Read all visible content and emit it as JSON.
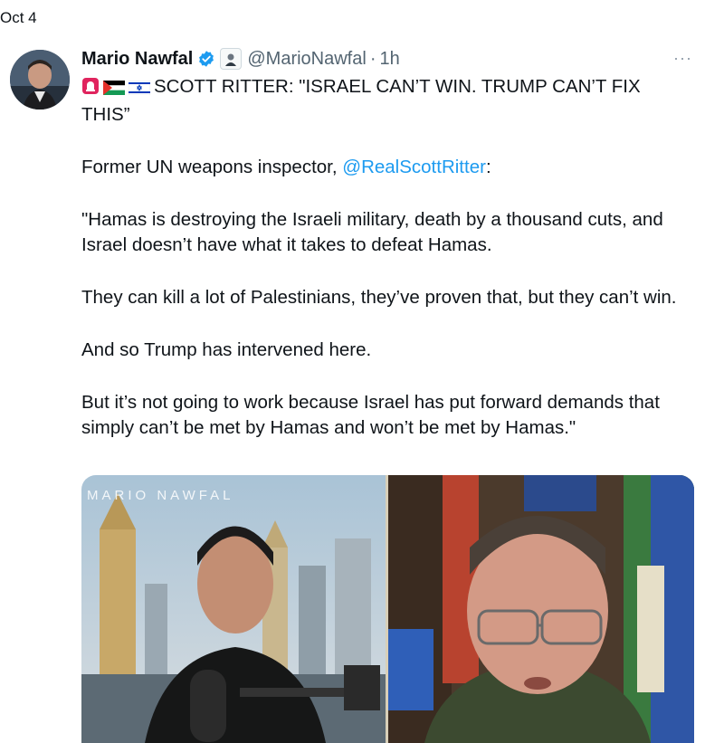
{
  "date_label": "Oct 4",
  "author": {
    "name": "Mario Nawfal",
    "handle": "@MarioNawfal",
    "separator": "·",
    "time": "1h"
  },
  "more_label": "···",
  "tweet": {
    "headline": "SCOTT RITTER: \"ISRAEL CAN’T WIN. TRUMP CAN’T FIX THIS”",
    "intro_prefix": "Former UN weapons inspector, ",
    "intro_mention": "@RealScottRitter",
    "intro_suffix": ":",
    "para1": "\"Hamas is destroying the Israeli military, death by a thousand cuts, and Israel doesn’t have what it takes to defeat Hamas.",
    "para2": "They can kill a lot of Palestinians, they’ve proven that, but they can’t win.",
    "para3": "And so Trump has intervened here.",
    "para4": "But it’s not going to work because Israel has put forward demands that simply can’t be met by Hamas and won’t be met by Hamas.\""
  },
  "media": {
    "watermark": "MARIO NAWFAL"
  },
  "colors": {
    "link": "#1d9bf0",
    "verified": "#1d9bf0",
    "secondary_text": "#536471"
  }
}
